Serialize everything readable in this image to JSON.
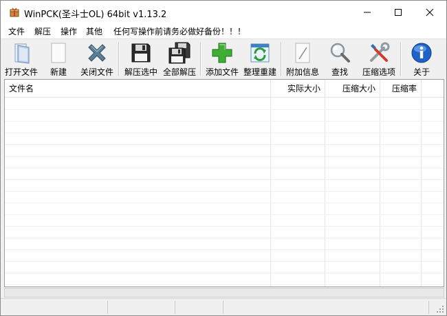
{
  "window": {
    "title": "WinPCK(圣斗士OL) 64bit v1.13.2"
  },
  "menu": [
    {
      "id": "file",
      "label": "文件"
    },
    {
      "id": "extract",
      "label": "解压"
    },
    {
      "id": "operate",
      "label": "操作"
    },
    {
      "id": "other",
      "label": "其他"
    },
    {
      "id": "warning",
      "label": "任何写操作前请务必做好备份！！！"
    }
  ],
  "toolbar": [
    {
      "id": "open-file",
      "label": "打开文件",
      "icon": "folder-open-icon"
    },
    {
      "id": "new",
      "label": "新建",
      "icon": "blank-page-icon"
    },
    {
      "id": "close-file",
      "label": "关闭文件",
      "icon": "x-close-icon"
    },
    {
      "id": "extract-selected",
      "label": "解压选中",
      "icon": "floppy-disk-icon"
    },
    {
      "id": "extract-all",
      "label": "全部解压",
      "icon": "floppy-disks-icon"
    },
    {
      "id": "add-file",
      "label": "添加文件",
      "icon": "green-plus-icon"
    },
    {
      "id": "rebuild",
      "label": "整理重建",
      "icon": "refresh-icon"
    },
    {
      "id": "attach-info",
      "label": "附加信息",
      "icon": "edit-page-icon"
    },
    {
      "id": "find",
      "label": "查找",
      "icon": "magnifier-icon"
    },
    {
      "id": "compress-options",
      "label": "压缩选项",
      "icon": "tools-icon"
    },
    {
      "id": "about",
      "label": "关于",
      "icon": "info-icon"
    }
  ],
  "columns": [
    {
      "id": "filename",
      "label": "文件名"
    },
    {
      "id": "actual-size",
      "label": "实际大小"
    },
    {
      "id": "compressed-size",
      "label": "压缩大小"
    },
    {
      "id": "ratio",
      "label": "压缩率"
    }
  ]
}
